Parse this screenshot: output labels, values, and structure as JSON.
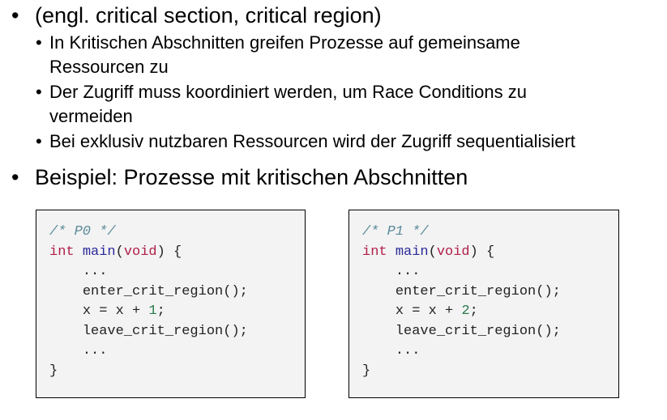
{
  "bullets": [
    {
      "symbol": "•",
      "text": "(engl. critical section, critical region)"
    },
    {
      "symbol": "•",
      "text": "In Kritischen Abschnitten greifen Prozesse auf gemeinsame"
    },
    {
      "symbol": "",
      "text": "Ressourcen zu"
    },
    {
      "symbol": "•",
      "text": "Der Zugriff muss koordiniert werden, um Race Conditions zu"
    },
    {
      "symbol": "",
      "text": "vermeiden"
    },
    {
      "symbol": "•",
      "text": "Bei exklusiv nutzbaren Ressourcen wird der Zugriff sequentialisiert"
    },
    {
      "symbol": "•",
      "text": "Beispiel: Prozesse mit kritischen Abschnitten"
    }
  ],
  "code_p0": {
    "comment": "/* P0 */",
    "kw_int": "int",
    "fn_main": "main",
    "paren_open": "(",
    "kw_void": "void",
    "paren_close_brace": ") {",
    "dots1": "...",
    "enter": "enter_crit_region();",
    "assign_pre": "x = x + ",
    "assign_num": "1",
    "assign_end": ";",
    "leave": "leave_crit_region();",
    "dots2": "...",
    "close": "}"
  },
  "code_p1": {
    "comment": "/* P1 */",
    "kw_int": "int",
    "fn_main": "main",
    "paren_open": "(",
    "kw_void": "void",
    "paren_close_brace": ") {",
    "dots1": "...",
    "enter": "enter_crit_region();",
    "assign_pre": "x = x + ",
    "assign_num": "2",
    "assign_end": ";",
    "leave": "leave_crit_region();",
    "dots2": "...",
    "close": "}"
  }
}
